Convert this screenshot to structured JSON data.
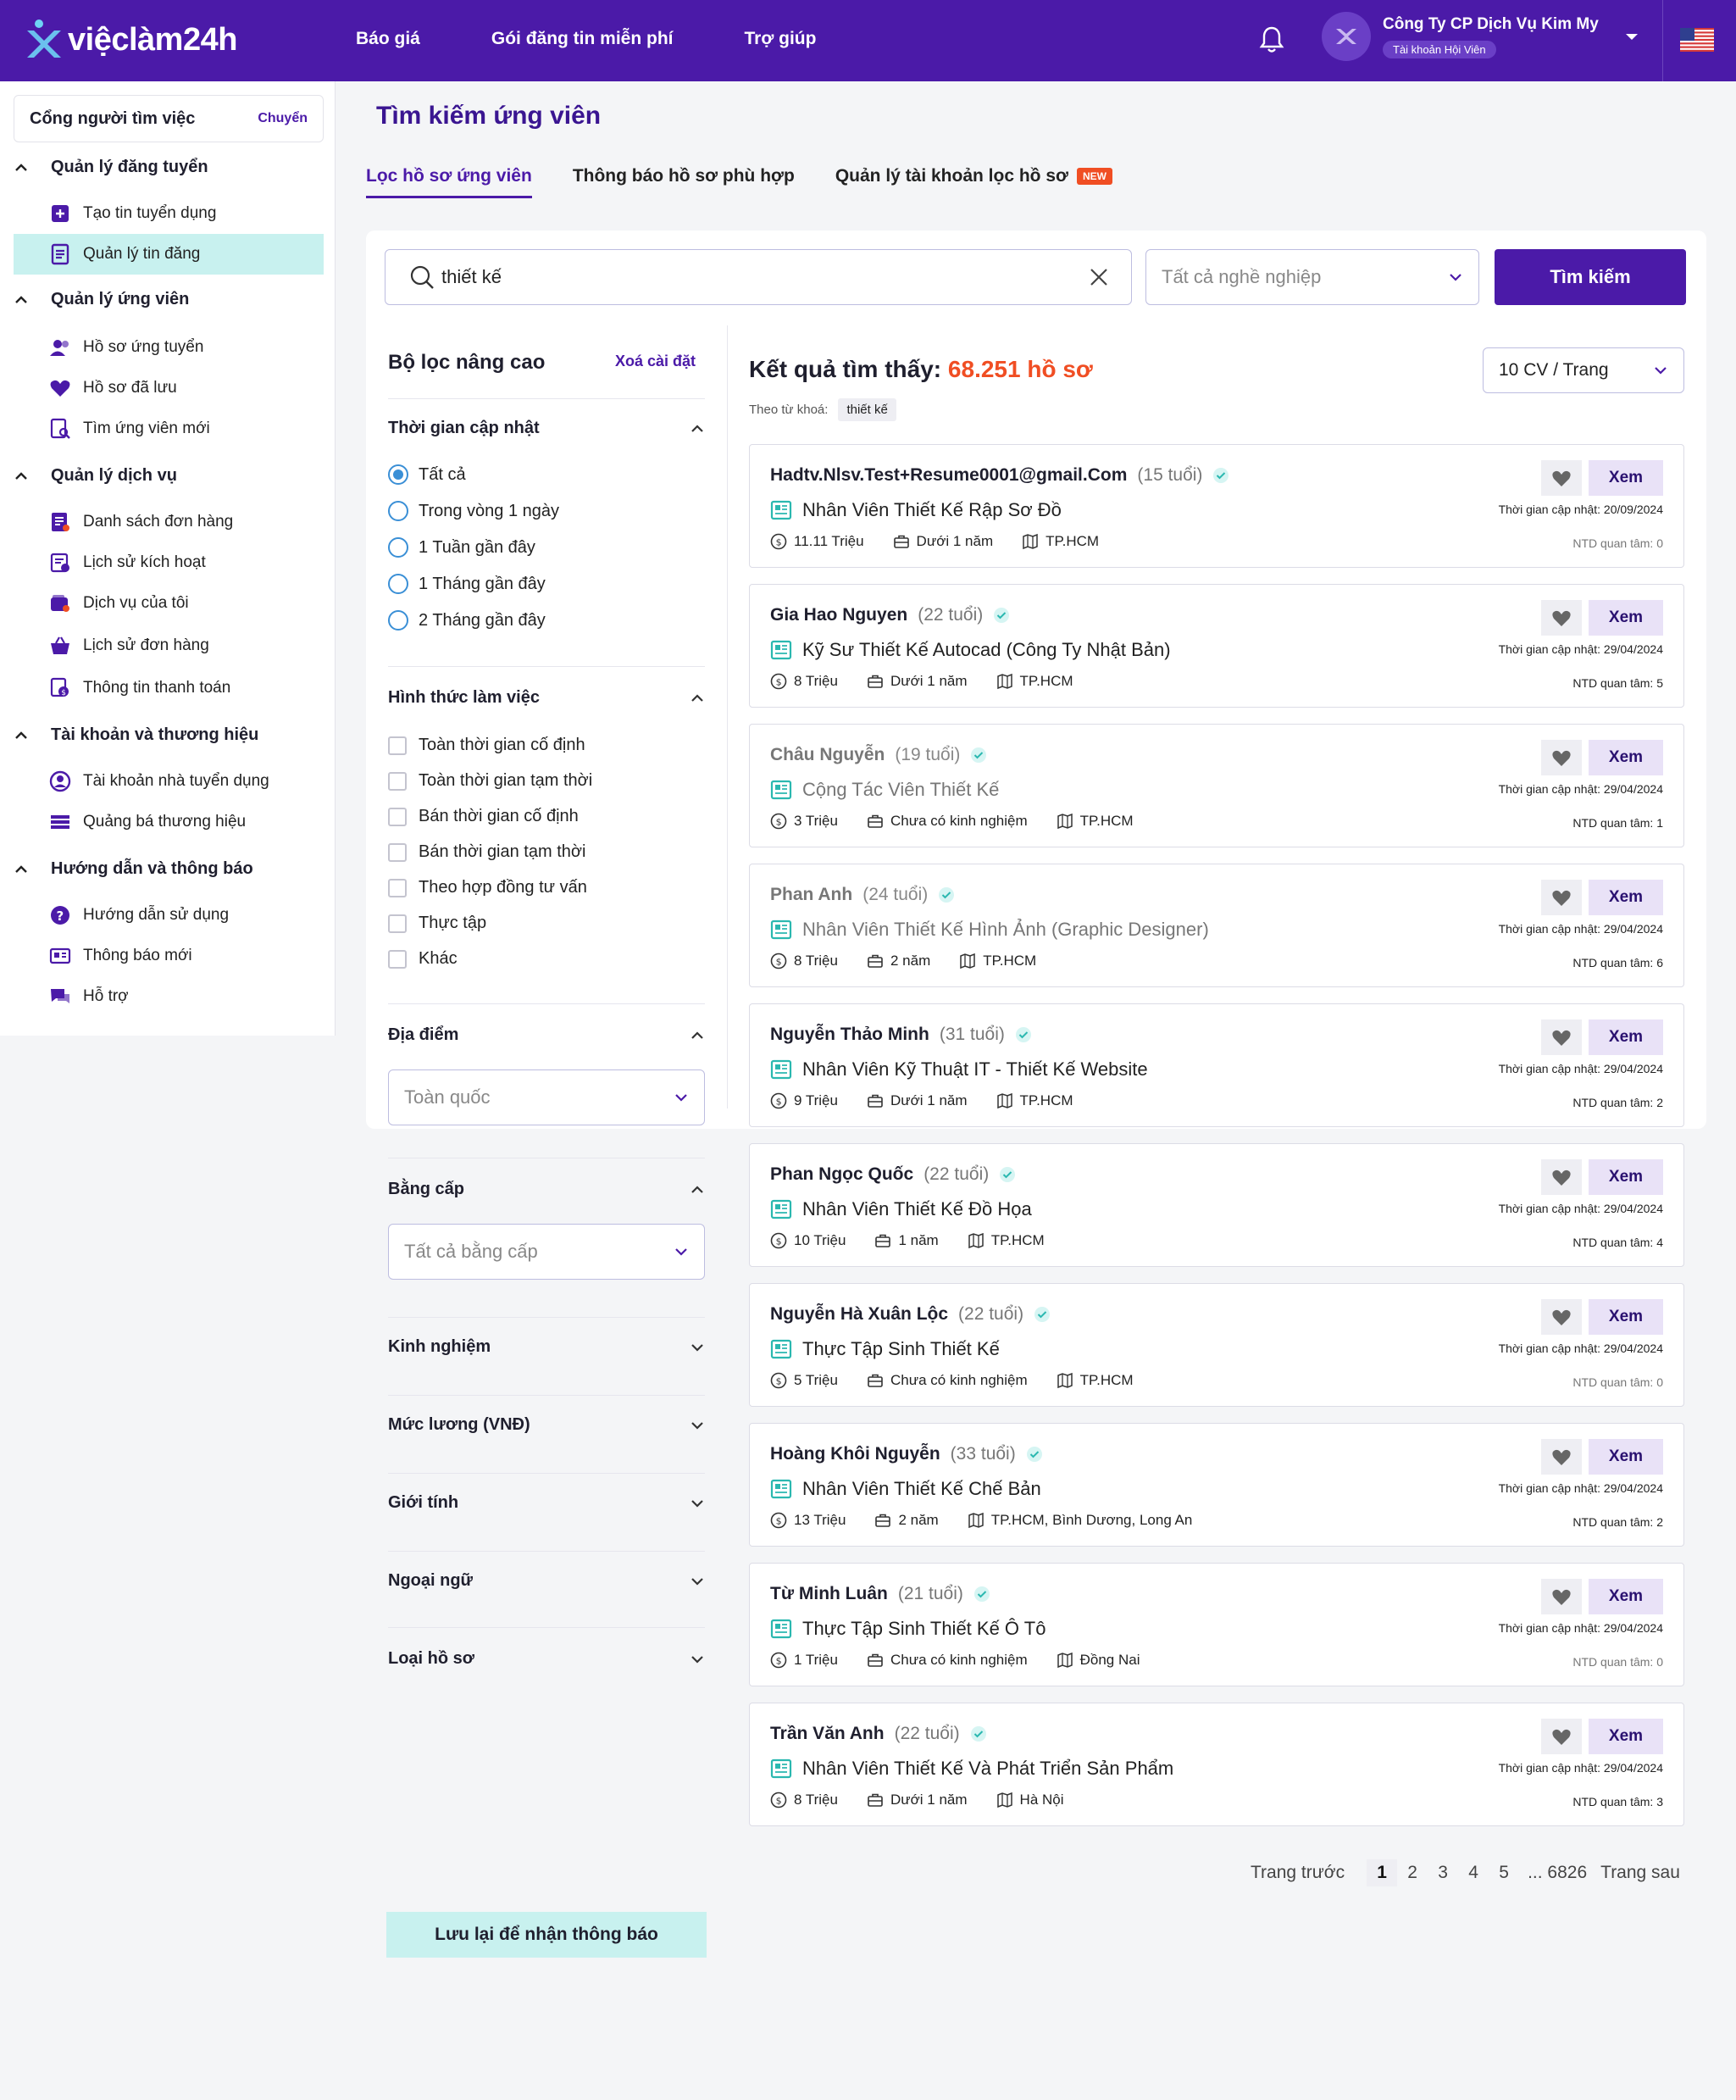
{
  "header": {
    "logo_text": "việclàm24h",
    "nav": [
      "Báo giá",
      "Gói đăng tin miễn phí",
      "Trợ giúp"
    ],
    "company": "Công Ty CP Dịch Vụ Kim My",
    "account_badge": "Tài khoản Hội Viên",
    "icons": [
      "bell-icon",
      "chevron-down-icon",
      "us-flag-icon"
    ]
  },
  "sidebar": {
    "portal_label": "Cổng người tìm việc",
    "portal_switch": "Chuyển",
    "sections": [
      {
        "title": "Quản lý đăng tuyển",
        "items": [
          "Tạo tin tuyển dụng",
          "Quản lý tin đăng"
        ]
      },
      {
        "title": "Quản lý ứng viên",
        "items": [
          "Hồ sơ ứng tuyển",
          "Hồ sơ đã lưu",
          "Tìm ứng viên mới"
        ]
      },
      {
        "title": "Quản lý dịch vụ",
        "items": [
          "Danh sách đơn hàng",
          "Lịch sử kích hoạt",
          "Dịch vụ của tôi",
          "Lịch sử đơn hàng",
          "Thông tin thanh toán"
        ]
      },
      {
        "title": "Tài khoản và thương hiệu",
        "items": [
          "Tài khoản nhà tuyển dụng",
          "Quảng bá thương hiệu"
        ]
      },
      {
        "title": "Hướng dẫn và thông báo",
        "items": [
          "Hướng dẫn sử dụng",
          "Thông báo mới",
          "Hỗ trợ"
        ]
      }
    ],
    "active_item": "Quản lý tin đăng"
  },
  "main": {
    "title": "Tìm kiếm ứng viên",
    "tabs": [
      "Lọc hồ sơ ứng viên",
      "Thông báo hồ sơ phù hợp",
      "Quản lý tài khoản lọc hồ sơ"
    ],
    "new_badge": "NEW",
    "search": {
      "value": "thiết kế",
      "career_placeholder": "Tất cả nghề nghiệp",
      "button": "Tìm kiếm"
    }
  },
  "filters": {
    "title": "Bộ lọc nâng cao",
    "reset": "Xoá cài đặt",
    "time": {
      "title": "Thời gian cập nhật",
      "options": [
        "Tất cả",
        "Trong vòng 1 ngày",
        "1 Tuần gần đây",
        "1 Tháng gần đây",
        "2 Tháng gần đây"
      ],
      "selected": 0
    },
    "work_type": {
      "title": "Hình thức làm việc",
      "options": [
        "Toàn thời gian cố định",
        "Toàn thời gian tạm thời",
        "Bán thời gian cố định",
        "Bán thời gian tạm thời",
        "Theo hợp đồng tư vấn",
        "Thực tập",
        "Khác"
      ]
    },
    "location": {
      "title": "Địa điểm",
      "value": "Toàn quốc"
    },
    "degree": {
      "title": "Bằng cấp",
      "value": "Tất cả bằng cấp"
    },
    "collapsed": [
      "Kinh nghiệm",
      "Mức lương (VNĐ)",
      "Giới tính",
      "Ngoại ngữ",
      "Loại hồ sơ"
    ],
    "save_button": "Lưu lại để nhận thông báo"
  },
  "results": {
    "label": "Kết quả tìm thấy:",
    "count": "68.251 hồ sơ",
    "per_page": "10 CV / Trang",
    "keyword_label": "Theo từ khoá:",
    "keyword": "thiết kế",
    "view_label": "Xem",
    "update_prefix": "Thời gian cập nhật:",
    "interest_prefix": "NTD quan tâm:",
    "items": [
      {
        "name": "Hadtv.Nlsv.Test+Resume0001@gmail.Com",
        "age": "(15 tuổi)",
        "job": "Nhân Viên Thiết Kế Rập Sơ Đồ",
        "salary": "11.11 Triệu",
        "exp": "Dưới 1 năm",
        "loc": "TP.HCM",
        "updated": "20/09/2024",
        "interest": "0",
        "dim": false
      },
      {
        "name": "Gia Hao Nguyen",
        "age": "(22 tuổi)",
        "job": "Kỹ Sư Thiết Kế Autocad (Công Ty Nhật Bản)",
        "salary": "8 Triệu",
        "exp": "Dưới 1 năm",
        "loc": "TP.HCM",
        "updated": "29/04/2024",
        "interest": "5",
        "dim": false
      },
      {
        "name": "Châu Nguyễn",
        "age": "(19 tuổi)",
        "job": "Cộng Tác Viên Thiết Kế",
        "salary": "3 Triệu",
        "exp": "Chưa có kinh nghiệm",
        "loc": "TP.HCM",
        "updated": "29/04/2024",
        "interest": "1",
        "dim": true
      },
      {
        "name": "Phan Anh",
        "age": "(24 tuổi)",
        "job": "Nhân Viên Thiết Kế Hình Ảnh (Graphic Designer)",
        "salary": "8 Triệu",
        "exp": "2 năm",
        "loc": "TP.HCM",
        "updated": "29/04/2024",
        "interest": "6",
        "dim": true
      },
      {
        "name": "Nguyễn Thảo Minh",
        "age": "(31 tuổi)",
        "job": "Nhân Viên Kỹ Thuật IT - Thiết Kế Website",
        "salary": "9 Triệu",
        "exp": "Dưới 1 năm",
        "loc": "TP.HCM",
        "updated": "29/04/2024",
        "interest": "2",
        "dim": false
      },
      {
        "name": "Phan Ngọc Quốc",
        "age": "(22 tuổi)",
        "job": "Nhân Viên Thiết Kế Đồ Họa",
        "salary": "10 Triệu",
        "exp": "1 năm",
        "loc": "TP.HCM",
        "updated": "29/04/2024",
        "interest": "4",
        "dim": false
      },
      {
        "name": "Nguyễn Hà Xuân Lộc",
        "age": "(22 tuổi)",
        "job": "Thực Tập Sinh Thiết Kế",
        "salary": "5 Triệu",
        "exp": "Chưa có kinh nghiệm",
        "loc": "TP.HCM",
        "updated": "29/04/2024",
        "interest": "0",
        "dim": false
      },
      {
        "name": "Hoàng Khôi Nguyễn",
        "age": "(33 tuổi)",
        "job": "Nhân Viên Thiết Kế Chế Bản",
        "salary": "13 Triệu",
        "exp": "2 năm",
        "loc": "TP.HCM, Bình Dương, Long An",
        "updated": "29/04/2024",
        "interest": "2",
        "dim": false
      },
      {
        "name": "Từ Minh Luân",
        "age": "(21 tuổi)",
        "job": "Thực Tập Sinh Thiết Kế Ô Tô",
        "salary": "1 Triệu",
        "exp": "Chưa có kinh nghiệm",
        "loc": "Đồng Nai",
        "updated": "29/04/2024",
        "interest": "0",
        "dim": false
      },
      {
        "name": "Trần Văn Anh",
        "age": "(22 tuổi)",
        "job": "Nhân Viên Thiết Kế Và Phát Triển Sản Phẩm",
        "salary": "8 Triệu",
        "exp": "Dưới 1 năm",
        "loc": "Hà Nội",
        "updated": "29/04/2024",
        "interest": "3",
        "dim": false
      }
    ]
  },
  "pagination": {
    "prev": "Trang trước",
    "pages": [
      "1",
      "2",
      "3",
      "4",
      "5"
    ],
    "last": "... 6826",
    "next": "Trang sau",
    "current": "1"
  },
  "colors": {
    "brand": "#4b1aa8",
    "accent": "#c8f1ef",
    "count": "#f04e23"
  }
}
